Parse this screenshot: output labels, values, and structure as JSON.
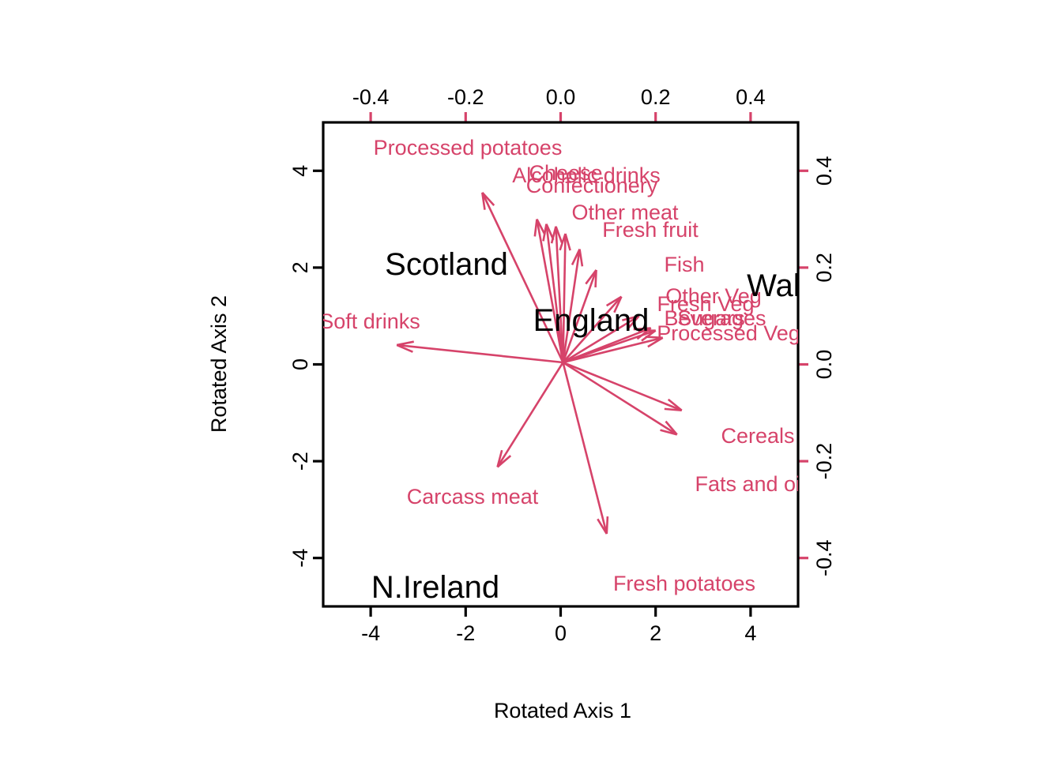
{
  "chart_data": {
    "type": "scatter",
    "subtype": "pca-biplot",
    "title": "",
    "xlabel": "Rotated Axis 1",
    "ylabel": "Rotated Axis 2",
    "grid": false,
    "legend": "none",
    "colors": {
      "observation": "#000000",
      "variable": "#D6436A",
      "box": "#000000"
    },
    "axes": {
      "bottom": {
        "label": "Rotated Axis 1",
        "ticks": [
          "-4",
          "-2",
          "0",
          "2",
          "4"
        ],
        "values": [
          -4,
          -2,
          0,
          2,
          4
        ],
        "color": "#000000",
        "range": [
          -5.0,
          5.0
        ]
      },
      "left": {
        "label": "Rotated Axis 2",
        "ticks": [
          "-4",
          "-2",
          "0",
          "2",
          "4"
        ],
        "values": [
          -4,
          -2,
          0,
          2,
          4
        ],
        "color": "#000000",
        "range": [
          -5.0,
          5.0
        ]
      },
      "top": {
        "label": "",
        "ticks": [
          "-0.4",
          "-0.2",
          "0.0",
          "0.2",
          "0.4"
        ],
        "values": [
          -0.4,
          -0.2,
          0.0,
          0.2,
          0.4
        ],
        "color": "#D6436A",
        "range": [
          -0.5,
          0.5
        ]
      },
      "right": {
        "label": "",
        "ticks": [
          "-0.4",
          "-0.2",
          "0.0",
          "0.2",
          "0.4"
        ],
        "values": [
          -0.4,
          -0.2,
          0.0,
          0.2,
          0.4
        ],
        "color": "#D6436A",
        "range": [
          -0.5,
          0.5
        ]
      }
    },
    "observations": [
      {
        "label": "Scotland",
        "x": -1.7,
        "y": 2.05
      },
      {
        "label": "England",
        "x": -0.05,
        "y": 0.83
      },
      {
        "label": "Wales",
        "x": 3.3,
        "y": 1.65
      },
      {
        "label": "N.Ireland",
        "x": -2.25,
        "y": -4.05
      }
    ],
    "variables": [
      {
        "label": "Processed potatoes",
        "x": -0.165,
        "y": 0.355,
        "tip_x": -0.165,
        "tip_y": 0.355
      },
      {
        "label": "Alcoholic drinks",
        "x": -0.05,
        "y": 0.3,
        "tip_x": -0.05,
        "tip_y": 0.3
      },
      {
        "label": "Cheese",
        "x": -0.03,
        "y": 0.29,
        "tip_x": -0.03,
        "tip_y": 0.29
      },
      {
        "label": "Confectionery",
        "x": -0.01,
        "y": 0.285,
        "tip_x": -0.01,
        "tip_y": 0.285
      },
      {
        "label": "Other meat",
        "x": 0.01,
        "y": 0.27,
        "tip_x": 0.01,
        "tip_y": 0.27
      },
      {
        "label": "Fresh fruit",
        "x": 0.04,
        "y": 0.238,
        "tip_x": 0.04,
        "tip_y": 0.238
      },
      {
        "label": "Fish",
        "x": 0.075,
        "y": 0.195,
        "tip_x": 0.075,
        "tip_y": 0.195
      },
      {
        "label": "Other Veg",
        "x": 0.128,
        "y": 0.14,
        "tip_x": 0.128,
        "tip_y": 0.14
      },
      {
        "label": "Fresh Veg",
        "x": 0.165,
        "y": 0.1,
        "tip_x": 0.165,
        "tip_y": 0.1
      },
      {
        "label": "Beverages",
        "x": 0.19,
        "y": 0.075,
        "tip_x": 0.19,
        "tip_y": 0.075
      },
      {
        "label": "Sugars",
        "x": 0.2,
        "y": 0.07,
        "tip_x": 0.2,
        "tip_y": 0.07
      },
      {
        "label": "Processed Veg",
        "x": 0.215,
        "y": 0.055,
        "tip_x": 0.215,
        "tip_y": 0.055
      },
      {
        "label": "Soft drinks",
        "x": -0.345,
        "y": 0.04,
        "tip_x": -0.345,
        "tip_y": 0.04
      },
      {
        "label": "Cereals",
        "x": 0.255,
        "y": -0.095,
        "tip_x": 0.255,
        "tip_y": -0.095
      },
      {
        "label": "Fats and oils",
        "x": 0.245,
        "y": -0.145,
        "tip_x": 0.245,
        "tip_y": -0.145
      },
      {
        "label": "Carcass meat",
        "x": -0.133,
        "y": -0.212,
        "tip_x": -0.133,
        "tip_y": -0.212
      },
      {
        "label": "Fresh potatoes",
        "x": 0.097,
        "y": -0.35,
        "tip_x": 0.097,
        "tip_y": -0.35
      }
    ],
    "variable_labels_visible": [
      "Processed potatoes",
      "Alcoholic drinks",
      "Cheese",
      "Confectionery",
      "Other meat",
      "Fresh fruit",
      "Fish",
      "Other Veg",
      "Fresh Veg",
      "Beverages",
      "Sugars",
      "Processed Veg",
      "oft drinks",
      "Cereals",
      "Fats and o",
      "Carcass meat",
      "Fresh potatoes"
    ]
  }
}
